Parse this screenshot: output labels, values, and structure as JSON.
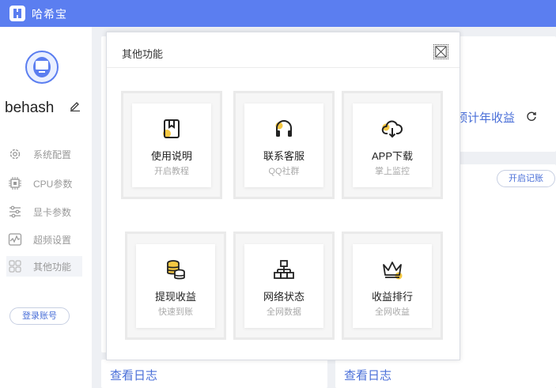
{
  "window": {
    "title": "哈希宝"
  },
  "sidebar": {
    "user_name": "behash",
    "items": [
      {
        "label": "系统配置",
        "icon": "gear-icon"
      },
      {
        "label": "CPU参数",
        "icon": "cpu-icon"
      },
      {
        "label": "显卡参数",
        "icon": "sliders-icon"
      },
      {
        "label": "超频设置",
        "icon": "pulse-icon"
      },
      {
        "label": "其他功能",
        "icon": "grid-icon"
      }
    ],
    "login_label": "登录账号"
  },
  "main": {
    "annual_label": "预计年收益",
    "open_record_label": "开启记账",
    "log_left": "查看日志",
    "log_right": "查看日志"
  },
  "modal": {
    "title": "其他功能",
    "tiles": [
      {
        "title": "使用说明",
        "sub": "开启教程",
        "icon": "book-icon"
      },
      {
        "title": "联系客服",
        "sub": "QQ社群",
        "icon": "headset-icon"
      },
      {
        "title": "APP下载",
        "sub": "掌上监控",
        "icon": "cloud-download-icon"
      },
      {
        "title": "提现收益",
        "sub": "快速到账",
        "icon": "coins-icon"
      },
      {
        "title": "网络状态",
        "sub": "全网数据",
        "icon": "network-icon"
      },
      {
        "title": "收益排行",
        "sub": "全网收益",
        "icon": "crown-icon"
      }
    ]
  },
  "colors": {
    "brand": "#5b7ef0",
    "link": "#4a6fd8",
    "accent": "#f5c842"
  }
}
